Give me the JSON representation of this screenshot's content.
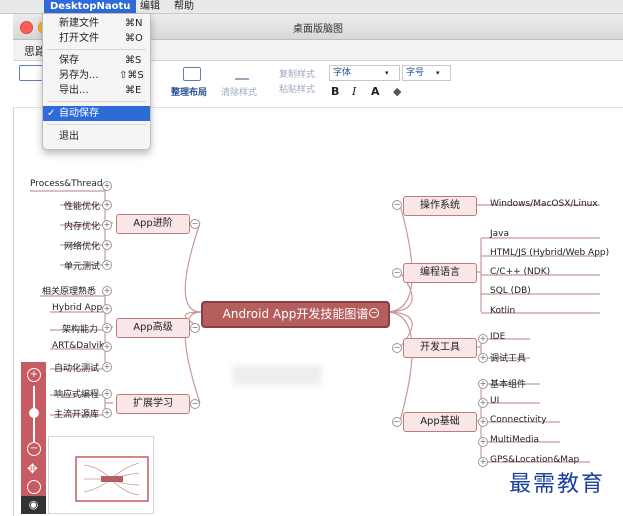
{
  "menubar": {
    "app": "DesktopNaotu",
    "edit": "编辑",
    "help": "帮助"
  },
  "window": {
    "title": "桌面版脑图",
    "tab": "思路"
  },
  "toolbar": {
    "organize": "整理布局",
    "clear_style": "清除样式",
    "copy_style": "复制样式",
    "paste_style": "粘贴样式",
    "font_select": "字体",
    "size_select": "字号",
    "bold": "B",
    "italic": "I",
    "font_color": "A",
    "bg_color": "◆"
  },
  "file_menu": {
    "items": [
      {
        "label": "新建文件",
        "shortcut": "⌘N"
      },
      {
        "label": "打开文件",
        "shortcut": "⌘O"
      },
      {
        "label": "保存",
        "shortcut": "⌘S"
      },
      {
        "label": "另存为...",
        "shortcut": "⇧⌘S"
      },
      {
        "label": "导出...",
        "shortcut": "⌘E"
      },
      {
        "label": "自动保存",
        "checked": true
      },
      {
        "label": "退出"
      }
    ]
  },
  "mindmap": {
    "root": "Android App开发技能图谱",
    "left_branches": [
      {
        "label": "App进阶",
        "children": [
          "Process&Thread",
          "性能优化",
          "内存优化",
          "网络优化",
          "单元测试"
        ]
      },
      {
        "label": "App高级",
        "children": [
          "相关原理熟悉",
          "Hybrid App",
          "架构能力",
          "ART&Dalvik",
          "自动化测试"
        ]
      },
      {
        "label": "扩展学习",
        "children": [
          "响应式编程",
          "主流开源库"
        ]
      }
    ],
    "right_branches": [
      {
        "label": "操作系统",
        "children": [
          "Windows/MacOSX/Linux"
        ]
      },
      {
        "label": "编程语言",
        "children": [
          "Java",
          "HTML/JS (Hybrid/Web App)",
          "C/C++ (NDK)",
          "SQL (DB)",
          "Kotlin"
        ]
      },
      {
        "label": "开发工具",
        "children": [
          "IDE",
          "调试工具"
        ]
      },
      {
        "label": "App基础",
        "children": [
          "基本组件",
          "UI",
          "Connectivity",
          "MultiMedia",
          "GPS&Location&Map"
        ]
      }
    ]
  },
  "watermark": "最需教育"
}
